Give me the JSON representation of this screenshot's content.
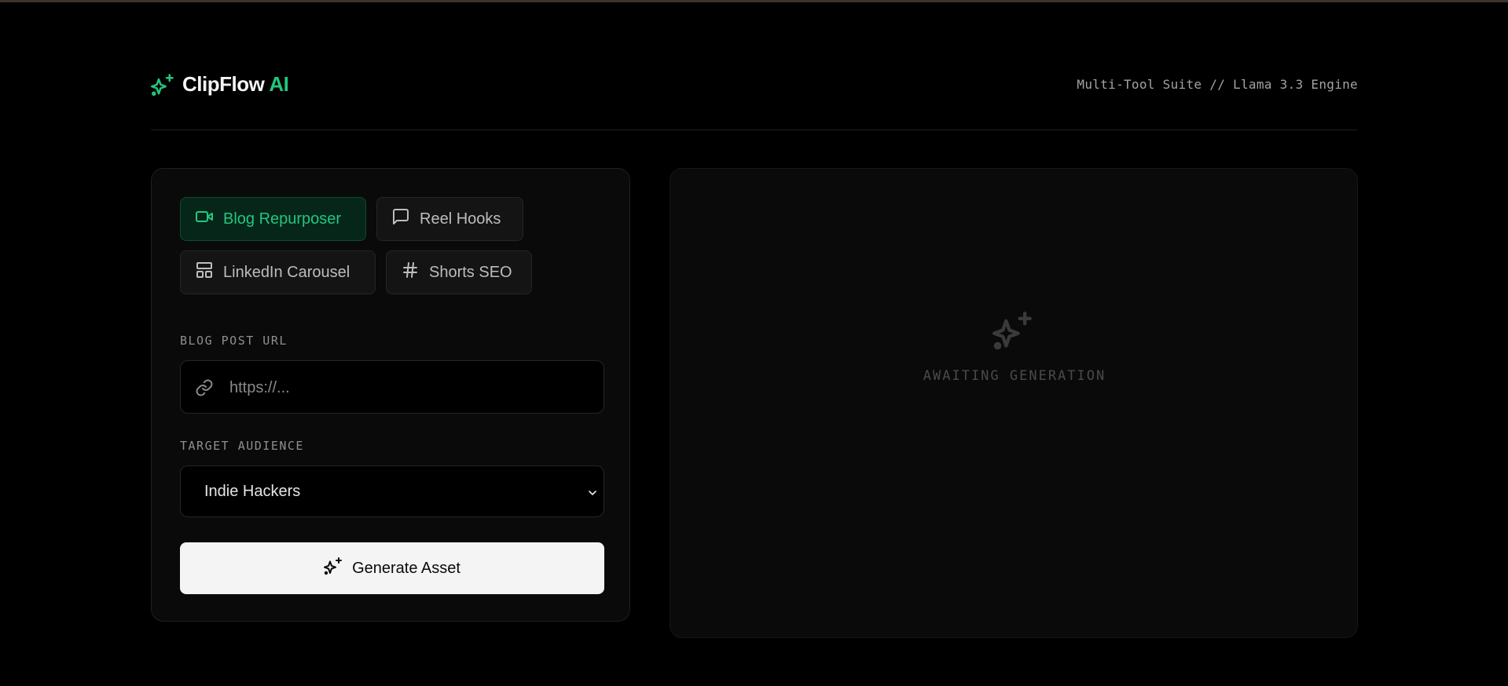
{
  "header": {
    "brand_name": "ClipFlow",
    "brand_accent": "AI",
    "engine_label": "Multi-Tool Suite // Llama 3.3 Engine"
  },
  "tabs": [
    {
      "label": "Blog Repurposer",
      "icon": "video-icon",
      "active": true
    },
    {
      "label": "Reel Hooks",
      "icon": "message-square-icon",
      "active": false
    },
    {
      "label": "LinkedIn Carousel",
      "icon": "layout-icon",
      "active": false
    },
    {
      "label": "Shorts SEO",
      "icon": "hash-icon",
      "active": false
    }
  ],
  "form": {
    "url_label": "BLOG POST URL",
    "url_placeholder": "https://...",
    "url_value": "",
    "audience_label": "TARGET AUDIENCE",
    "audience_value": "Indie Hackers",
    "generate_label": "Generate Asset"
  },
  "output": {
    "status_text": "AWAITING GENERATION"
  },
  "colors": {
    "accent": "#22c77e",
    "background": "#000000",
    "card": "#0a0a0a",
    "button": "#f4f4f4"
  }
}
